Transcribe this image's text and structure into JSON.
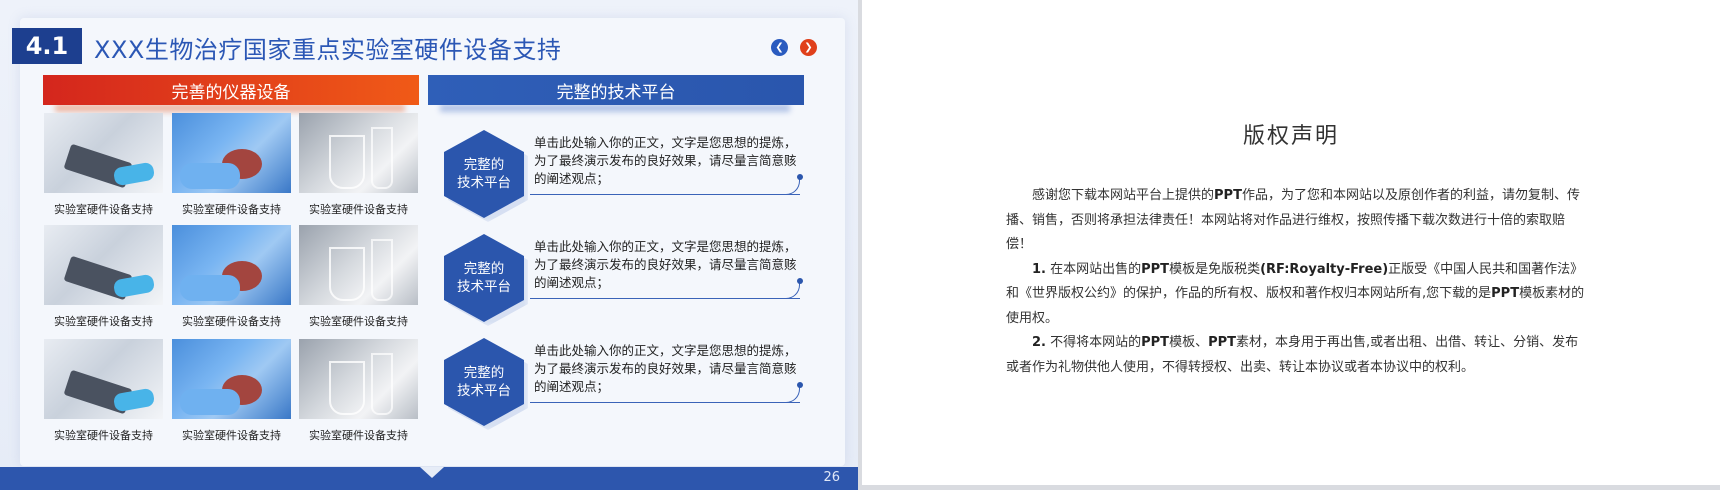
{
  "left_slide": {
    "section_number": "4.1",
    "title": "XXX生物治疗国家重点实验室硬件设备支持",
    "nav": {
      "prev_icon": "arrow-left-icon",
      "next_icon": "arrow-right-icon",
      "prev_color": "#2a5bbf",
      "next_color": "#e0401b"
    },
    "instruments_header": "完善的仪器设备",
    "platform_header": "完整的技术平台",
    "gallery": [
      {
        "image": "tablet-lab-photo",
        "caption": "实验室硬件设备支持"
      },
      {
        "image": "gloved-hands-photo",
        "caption": "实验室硬件设备支持"
      },
      {
        "image": "glassware-photo",
        "caption": "实验室硬件设备支持"
      },
      {
        "image": "tablet-lab-photo",
        "caption": "实验室硬件设备支持"
      },
      {
        "image": "gloved-hands-photo",
        "caption": "实验室硬件设备支持"
      },
      {
        "image": "glassware-photo",
        "caption": "实验室硬件设备支持"
      },
      {
        "image": "tablet-lab-photo",
        "caption": "实验室硬件设备支持"
      },
      {
        "image": "gloved-hands-photo",
        "caption": "实验室硬件设备支持"
      },
      {
        "image": "glassware-photo",
        "caption": "实验室硬件设备支持"
      }
    ],
    "platforms": [
      {
        "hex_line1": "完整的",
        "hex_line2": "技术平台",
        "text": "单击此处输入你的正文，文字是您思想的提炼，为了最终演示发布的良好效果，请尽量言简意赅的阐述观点；"
      },
      {
        "hex_line1": "完整的",
        "hex_line2": "技术平台",
        "text": "单击此处输入你的正文，文字是您思想的提炼，为了最终演示发布的良好效果，请尽量言简意赅的阐述观点；"
      },
      {
        "hex_line1": "完整的",
        "hex_line2": "技术平台",
        "text": "单击此处输入你的正文，文字是您思想的提炼，为了最终演示发布的良好效果，请尽量言简意赅的阐述观点；"
      }
    ],
    "page_number": "26",
    "colors": {
      "primary_blue": "#2b56ad",
      "accent_red": "#d4261d",
      "accent_orange": "#f05a17"
    }
  },
  "right_slide": {
    "title": "版权声明",
    "para1_a": "感谢您下载本网站平台上提供的",
    "para1_b": "PPT",
    "para1_c": "作品，为了您和本网站以及原创作者的利益，请勿复制、传播、销售，否则将承担法律责任！本网站将对作品进行维权，按照传播下载次数进行十倍的索取赔偿！",
    "para2_num": "1.",
    "para2_a": " 在本网站出售的",
    "para2_b": "PPT",
    "para2_c": "模板是免版税类",
    "para2_d": "(RF:Royalty-Free)",
    "para2_e": "正版受《中国人民共和国著作法》和《世界版权公约》的保护，作品的所有权、版权和著作权归本网站所有,您下载的是",
    "para2_f": "PPT",
    "para2_g": "模板素材的使用权。",
    "para3_num": "2.",
    "para3_a": " 不得将本网站的",
    "para3_b": "PPT",
    "para3_c": "模板、",
    "para3_d": "PPT",
    "para3_e": "素材，本身用于再出售,或者出租、出借、转让、分销、发布或者作为礼物供他人使用，不得转授权、出卖、转让本协议或者本协议中的权利。"
  }
}
